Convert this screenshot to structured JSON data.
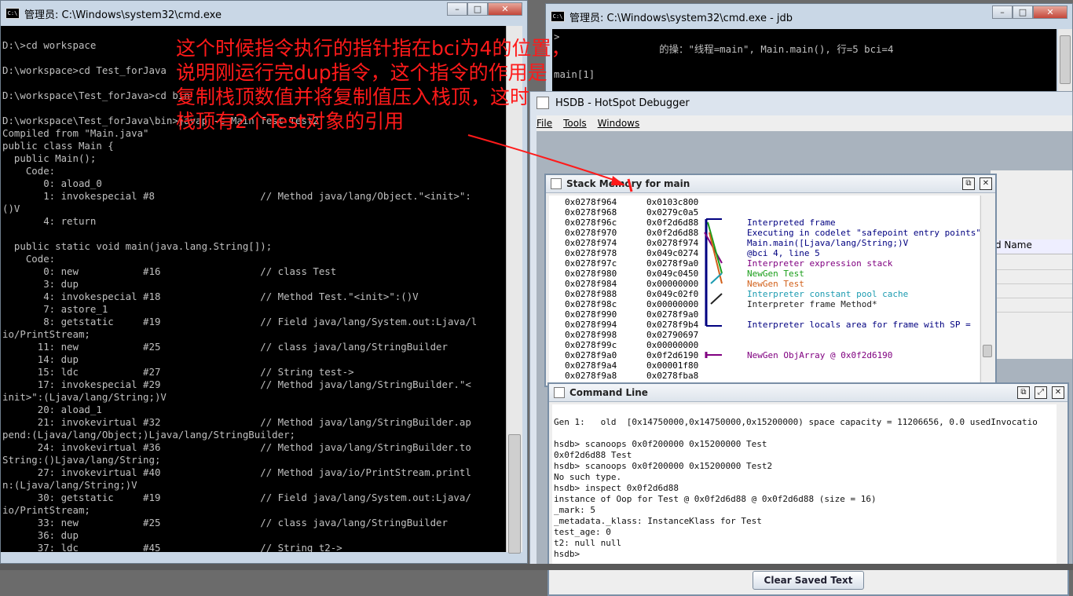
{
  "cmd_window": {
    "title": "管理员: C:\\Windows\\system32\\cmd.exe",
    "icon_text": "C:\\",
    "lines": [
      "",
      "D:\\>cd workspace",
      "",
      "D:\\workspace>cd Test_forJava",
      "",
      "D:\\workspace\\Test_forJava>cd bin",
      "",
      "D:\\workspace\\Test_forJava\\bin>javap -c Main Test Test2",
      "Compiled from \"Main.java\"",
      "public class Main {",
      "  public Main();",
      "    Code:",
      "       0: aload_0",
      "       1: invokespecial #8                  // Method java/lang/Object.\"<init>\":",
      "()V",
      "       4: return",
      "",
      "  public static void main(java.lang.String[]);",
      "    Code:",
      "       0: new           #16                 // class Test",
      "       3: dup",
      "       4: invokespecial #18                 // Method Test.\"<init>\":()V",
      "       7: astore_1",
      "       8: getstatic     #19                 // Field java/lang/System.out:Ljava/l",
      "io/PrintStream;",
      "      11: new           #25                 // class java/lang/StringBuilder",
      "      14: dup",
      "      15: ldc           #27                 // String test->",
      "      17: invokespecial #29                 // Method java/lang/StringBuilder.\"<",
      "init>\":(Ljava/lang/String;)V",
      "      20: aload_1",
      "      21: invokevirtual #32                 // Method java/lang/StringBuilder.ap",
      "pend:(Ljava/lang/Object;)Ljava/lang/StringBuilder;",
      "      24: invokevirtual #36                 // Method java/lang/StringBuilder.to",
      "String:()Ljava/lang/String;",
      "      27: invokevirtual #40                 // Method java/io/PrintStream.printl",
      "n:(Ljava/lang/String;)V",
      "      30: getstatic     #19                 // Field java/lang/System.out:Ljava/",
      "io/PrintStream;",
      "      33: new           #25                 // class java/lang/StringBuilder",
      "      36: dup",
      "      37: ldc           #45                 // String t2->"
    ]
  },
  "jdb_window": {
    "title": "管理员: C:\\Windows\\system32\\cmd.exe - jdb",
    "icon_text": "C:\\",
    "lines": [
      ">",
      "                  的操：\"线程=main\", Main.main(), 行=5 bci=4",
      "",
      "main[1]"
    ]
  },
  "hsdb": {
    "title": "HSDB - HotSpot Debugger",
    "menu": [
      "File",
      "Tools",
      "Windows"
    ],
    "right_header": "d Name"
  },
  "stack_memory": {
    "title": "Stack Memory for main",
    "rows": [
      {
        "addr": "0x0278f964",
        "val": "0x0103c800"
      },
      {
        "addr": "0x0278f968",
        "val": "0x0279c0a5"
      },
      {
        "addr": "0x0278f96c",
        "val": "0x0f2d6d88"
      },
      {
        "addr": "0x0278f970",
        "val": "0x0f2d6d88"
      },
      {
        "addr": "0x0278f974",
        "val": "0x0278f974"
      },
      {
        "addr": "0x0278f978",
        "val": "0x049c0274"
      },
      {
        "addr": "0x0278f97c",
        "val": "0x0278f9a0"
      },
      {
        "addr": "0x0278f980",
        "val": "0x049c0450"
      },
      {
        "addr": "0x0278f984",
        "val": "0x00000000"
      },
      {
        "addr": "0x0278f988",
        "val": "0x049c02f0"
      },
      {
        "addr": "0x0278f98c",
        "val": "0x00000000"
      },
      {
        "addr": "0x0278f990",
        "val": "0x0278f9a0"
      },
      {
        "addr": "0x0278f994",
        "val": "0x0278f9b4"
      },
      {
        "addr": "0x0278f998",
        "val": "0x02790697"
      },
      {
        "addr": "0x0278f99c",
        "val": "0x00000000"
      },
      {
        "addr": "0x0278f9a0",
        "val": "0x0f2d6190"
      },
      {
        "addr": "0x0278f9a4",
        "val": "0x00001f80"
      },
      {
        "addr": "0x0278f9a8",
        "val": "0x0278fba8"
      }
    ],
    "annotations": [
      {
        "text": "Interpreted frame",
        "color": "#000080",
        "row": 2
      },
      {
        "text": "Executing in codelet \"safepoint entry points\"",
        "color": "#000080",
        "row": 3
      },
      {
        "text": "Main.main([Ljava/lang/String;)V",
        "color": "#000080",
        "row": 4
      },
      {
        "text": "@bci 4, line 5",
        "color": "#000080",
        "row": 5
      },
      {
        "text": "Interpreter expression stack",
        "color": "#800080",
        "row": 6
      },
      {
        "text": "NewGen Test",
        "color": "#1a9e1a",
        "row": 7
      },
      {
        "text": "NewGen Test",
        "color": "#d2601a",
        "row": 8
      },
      {
        "text": "Interpreter constant pool cache",
        "color": "#1b9bb0",
        "row": 9
      },
      {
        "text": "Interpreter frame Method*",
        "color": "#222222",
        "row": 10
      },
      {
        "text": "Interpreter locals area for frame with SP =",
        "color": "#000080",
        "row": 12
      },
      {
        "text": "NewGen ObjArray @ 0x0f2d6190",
        "color": "#800080",
        "row": 15
      }
    ]
  },
  "command_line": {
    "title": "Command Line",
    "lines": [
      "",
      "Gen 1:   old  [0x14750000,0x14750000,0x15200000) space capacity = 11206656, 0.0 usedInvocatio",
      "",
      "hsdb> scanoops 0x0f200000 0x15200000 Test",
      "0x0f2d6d88 Test",
      "hsdb> scanoops 0x0f200000 0x15200000 Test2",
      "No such type.",
      "hsdb> inspect 0x0f2d6d88",
      "instance of Oop for Test @ 0x0f2d6d88 @ 0x0f2d6d88 (size = 16)",
      "_mark: 5",
      "_metadata._klass: InstanceKlass for Test",
      "test_age: 0",
      "t2: null null",
      "hsdb>"
    ],
    "clear_button": "Clear Saved Text"
  },
  "note": {
    "text": "这个时候指令执行的指针指在bci为4的位置，\n说明刚运行完dup指令，这个指令的作用是\n复制栈顶数值并将复制值压入栈顶，这时\n栈顶有2个Test对象的引用",
    "color": "#ff1a1a"
  },
  "window_buttons": {
    "minimize": "–",
    "maximize": "□",
    "close": "✕"
  }
}
